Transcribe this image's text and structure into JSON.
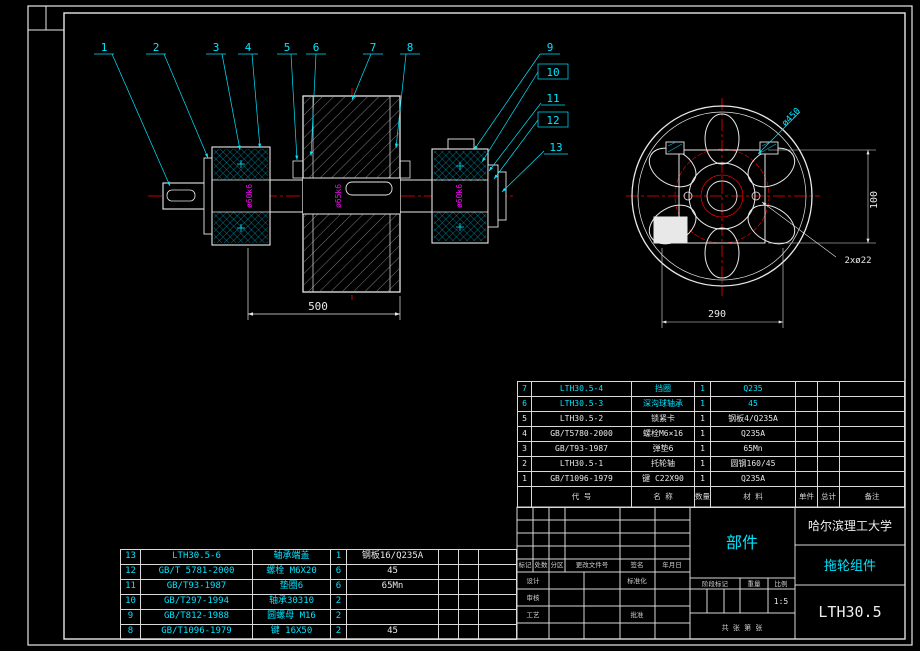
{
  "colors": {
    "accent": "#00e5ff",
    "centerline": "#ff0000",
    "dia_label": "#ff00ff",
    "line": "#e8e8e8"
  },
  "drawing": {
    "callouts": [
      "1",
      "2",
      "3",
      "4",
      "5",
      "6",
      "7",
      "8",
      "9",
      "10",
      "11",
      "12",
      "13"
    ],
    "dims": {
      "span": "500",
      "base": "290",
      "height": "100",
      "holes": "2xø22",
      "outer_dia": "ø450",
      "dia_left": "ø60k6",
      "dia_mid": "ø65k6",
      "dia_right": "ø60k6"
    }
  },
  "parts_upper": {
    "headers": {
      "code": "代 号",
      "name": "名 称",
      "qty": "数量",
      "mat": "材 料",
      "unit": "单件",
      "total": "总计",
      "note": "备注"
    },
    "rows": [
      {
        "n": "7",
        "code": "LTH30.5-4",
        "name": "挡圈",
        "qty": "1",
        "mat": "Q235",
        "note": "",
        "color": "#00e5ff"
      },
      {
        "n": "6",
        "code": "LTH30.5-3",
        "name": "深沟球轴承",
        "qty": "1",
        "mat": "45",
        "note": "",
        "color": "#00e5ff"
      },
      {
        "n": "5",
        "code": "LTH30.5-2",
        "name": "锁紧卡",
        "qty": "1",
        "mat": "钢板4/Q235A",
        "note": "",
        "color": "#e8e8e8"
      },
      {
        "n": "4",
        "code": "GB/T5780-2000",
        "name": "螺栓M6×16",
        "qty": "1",
        "mat": "Q235A",
        "note": "",
        "color": "#e8e8e8"
      },
      {
        "n": "3",
        "code": "GB/T93-1987",
        "name": "弹垫6",
        "qty": "1",
        "mat": "65Mn",
        "note": "",
        "color": "#e8e8e8"
      },
      {
        "n": "2",
        "code": "LTH30.5-1",
        "name": "托轮轴",
        "qty": "1",
        "mat": "圆钢160/45",
        "note": "",
        "color": "#e8e8e8"
      },
      {
        "n": "1",
        "code": "GB/T1096-1979",
        "name": "键 C22X90",
        "qty": "1",
        "mat": "Q235A",
        "note": "",
        "color": "#e8e8e8"
      }
    ]
  },
  "parts_lower": {
    "rows": [
      {
        "n": "13",
        "code": "LTH30.5-6",
        "name": "轴承端盖",
        "qty": "1",
        "mat": "钢板16/Q235A",
        "color": "#00e5ff"
      },
      {
        "n": "12",
        "code": "GB/T 5781-2000",
        "name": "螺栓 M6X20",
        "qty": "6",
        "mat": "45",
        "color": "#00e5ff"
      },
      {
        "n": "11",
        "code": "GB/T93-1987",
        "name": "垫圈6",
        "qty": "6",
        "mat": "65Mn",
        "color": "#00e5ff"
      },
      {
        "n": "10",
        "code": "GB/T297-1994",
        "name": "轴承30310",
        "qty": "2",
        "mat": "",
        "color": "#00e5ff"
      },
      {
        "n": "9",
        "code": "GB/T812-1988",
        "name": "圆螺母 M16",
        "qty": "2",
        "mat": "",
        "color": "#00e5ff"
      },
      {
        "n": "8",
        "code": "GB/T1096-1979",
        "name": "键 16X50",
        "qty": "2",
        "mat": "45",
        "color": "#00e5ff"
      }
    ]
  },
  "title_block": {
    "company": "哈尔滨理工大学",
    "doc_type": "部件",
    "part_name": "拖轮组件",
    "drawing_no": "LTH30.5",
    "scale_value": "1:5",
    "labels": {
      "mark": "标记",
      "count": "处数",
      "zone": "分区",
      "file": "更改文件号",
      "sign": "签名",
      "date": "年月日",
      "design": "设计",
      "check": "审核",
      "process": "工艺",
      "standard": "标准化",
      "approve": "批准",
      "stage": "阶段标记",
      "weight": "重量",
      "scale": "比例",
      "sheets": "共 张 第 张"
    }
  }
}
